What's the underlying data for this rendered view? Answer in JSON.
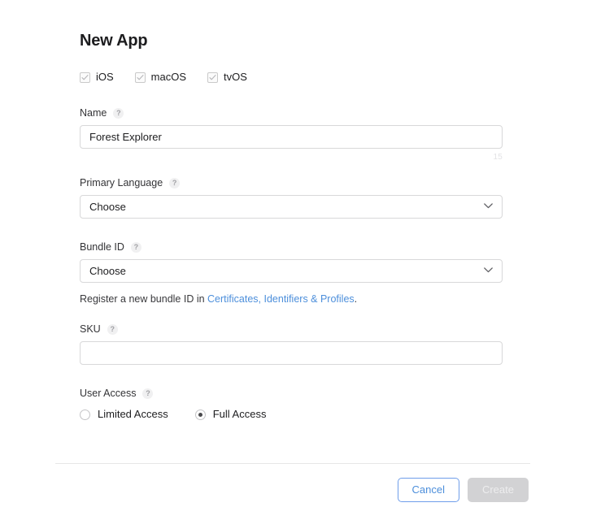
{
  "form": {
    "title": "New App",
    "platforms": [
      {
        "label": "iOS",
        "checked": true
      },
      {
        "label": "macOS",
        "checked": true
      },
      {
        "label": "tvOS",
        "checked": true
      }
    ],
    "name_field": {
      "label": "Name",
      "help": "?",
      "value": "Forest Explorer",
      "placeholder": "",
      "counter": "15"
    },
    "primary_language": {
      "label": "Primary Language",
      "help": "?",
      "value": "Choose"
    },
    "bundle_id": {
      "label": "Bundle ID",
      "help": "?",
      "value": "Choose",
      "hint_prefix": "Register a new bundle ID in ",
      "hint_link": "Certificates, Identifiers & Profiles",
      "hint_suffix": "."
    },
    "sku": {
      "label": "SKU",
      "help": "?",
      "value": "",
      "placeholder": ""
    },
    "user_access": {
      "label": "User Access",
      "help": "?",
      "options": [
        {
          "label": "Limited Access",
          "selected": false
        },
        {
          "label": "Full Access",
          "selected": true
        }
      ]
    }
  },
  "footer": {
    "cancel_label": "Cancel",
    "create_label": "Create"
  },
  "colors": {
    "link": "#4d8fdb",
    "accent": "#4d8fdb",
    "border": "#d8d8d9",
    "disabled_bg": "#d2d2d4",
    "text": "#1d1d1f"
  }
}
